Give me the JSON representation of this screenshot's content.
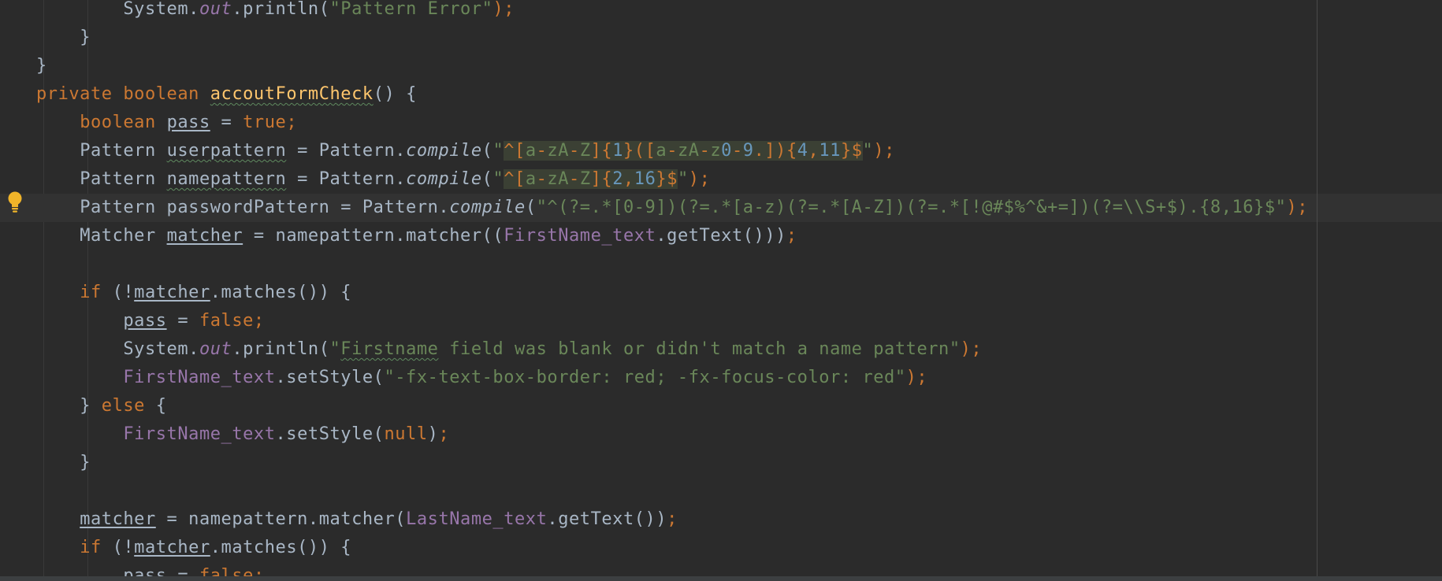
{
  "editor": {
    "colors": {
      "background": "#2b2b2b",
      "keyword": "#cc7832",
      "string": "#6a8759",
      "number": "#6897bb",
      "field": "#9876aa",
      "method_decl": "#ffc66d",
      "plain": "#a9b7c6",
      "intention_bulb": "#f0b429"
    },
    "gutter_icon": "intention-bulb-icon",
    "lines": [
      {
        "indent": "        ",
        "tokens": [
          [
            "plain",
            "System."
          ],
          [
            "st",
            "out"
          ],
          [
            "plain",
            ".println("
          ],
          [
            "str",
            "\"Pattern Error\""
          ],
          [
            "kw",
            ");"
          ]
        ]
      },
      {
        "indent": "    ",
        "tokens": [
          [
            "plain",
            "}"
          ]
        ]
      },
      {
        "indent": "",
        "tokens": [
          [
            "plain",
            "}"
          ]
        ]
      },
      {
        "indent": "",
        "tokens": [
          [
            "kw",
            "private "
          ],
          [
            "kw",
            "boolean "
          ],
          [
            "fn_typo",
            "accoutFormCheck"
          ],
          [
            "plain",
            "() {"
          ]
        ]
      },
      {
        "indent": "    ",
        "tokens": [
          [
            "kw",
            "boolean "
          ],
          [
            "ul",
            "pass"
          ],
          [
            "plain",
            " = "
          ],
          [
            "kw",
            "true;"
          ]
        ]
      },
      {
        "indent": "    ",
        "tokens": [
          [
            "plain",
            "Pattern "
          ],
          [
            "ul_typo",
            "userpattern"
          ],
          [
            "plain",
            " = Pattern."
          ],
          [
            "mc",
            "compile"
          ],
          [
            "plain",
            "("
          ],
          [
            "str",
            "\""
          ],
          [
            "rx",
            "^[a-zA-Z]{1}([a-zA-z0-9.]){4,11}$"
          ],
          [
            "str",
            "\""
          ],
          [
            "kw",
            ");"
          ]
        ]
      },
      {
        "indent": "    ",
        "tokens": [
          [
            "plain",
            "Pattern "
          ],
          [
            "ul_typo",
            "namepattern"
          ],
          [
            "plain",
            " = Pattern."
          ],
          [
            "mc",
            "compile"
          ],
          [
            "plain",
            "("
          ],
          [
            "str",
            "\""
          ],
          [
            "rx",
            "^[a-zA-Z]{2,16}$"
          ],
          [
            "str",
            "\""
          ],
          [
            "kw",
            ");"
          ]
        ]
      },
      {
        "indent": "    ",
        "tokens": [
          [
            "plain",
            "Pattern passwordPattern = Pattern."
          ],
          [
            "mc",
            "compile"
          ],
          [
            "plain",
            "("
          ],
          [
            "str",
            "\"^(?=.*[0-9])(?=.*[a-z)(?=.*[A-Z])(?=.*[!@#$%^&+=])(?=\\\\S+$).{8,16}$\""
          ],
          [
            "kw",
            ");"
          ]
        ]
      },
      {
        "indent": "    ",
        "tokens": [
          [
            "plain",
            "Matcher "
          ],
          [
            "ul",
            "matcher"
          ],
          [
            "plain",
            " = namepattern.matcher(("
          ],
          [
            "fld",
            "FirstName_text"
          ],
          [
            "plain",
            ".getText()))"
          ],
          [
            "kw",
            ";"
          ]
        ]
      },
      {
        "indent": "",
        "tokens": []
      },
      {
        "indent": "    ",
        "tokens": [
          [
            "kw",
            "if "
          ],
          [
            "plain",
            "(!"
          ],
          [
            "ul",
            "matcher"
          ],
          [
            "plain",
            ".matches()) {"
          ]
        ]
      },
      {
        "indent": "        ",
        "tokens": [
          [
            "ul",
            "pass"
          ],
          [
            "plain",
            " = "
          ],
          [
            "kw",
            "false;"
          ]
        ]
      },
      {
        "indent": "        ",
        "tokens": [
          [
            "plain",
            "System."
          ],
          [
            "st",
            "out"
          ],
          [
            "plain",
            ".println("
          ],
          [
            "str",
            "\""
          ],
          [
            "str_typo",
            "Firstname"
          ],
          [
            "str",
            " field was blank or didn't match a name pattern\""
          ],
          [
            "kw",
            ");"
          ]
        ]
      },
      {
        "indent": "        ",
        "tokens": [
          [
            "fld",
            "FirstName_text"
          ],
          [
            "plain",
            ".setStyle("
          ],
          [
            "str",
            "\"-fx-text-box-border: red; -fx-focus-color: red\""
          ],
          [
            "kw",
            ");"
          ]
        ]
      },
      {
        "indent": "    ",
        "tokens": [
          [
            "plain",
            "} "
          ],
          [
            "kw",
            "else "
          ],
          [
            "plain",
            "{"
          ]
        ]
      },
      {
        "indent": "        ",
        "tokens": [
          [
            "fld",
            "FirstName_text"
          ],
          [
            "plain",
            ".setStyle("
          ],
          [
            "kw",
            "null"
          ],
          [
            "plain",
            ")"
          ],
          [
            "kw",
            ";"
          ]
        ]
      },
      {
        "indent": "    ",
        "tokens": [
          [
            "plain",
            "}"
          ]
        ]
      },
      {
        "indent": "",
        "tokens": []
      },
      {
        "indent": "    ",
        "tokens": [
          [
            "ul",
            "matcher"
          ],
          [
            "plain",
            " = namepattern.matcher("
          ],
          [
            "fld",
            "LastName_text"
          ],
          [
            "plain",
            ".getText())"
          ],
          [
            "kw",
            ";"
          ]
        ]
      },
      {
        "indent": "    ",
        "tokens": [
          [
            "kw",
            "if "
          ],
          [
            "plain",
            "(!"
          ],
          [
            "ul",
            "matcher"
          ],
          [
            "plain",
            ".matches()) {"
          ]
        ]
      },
      {
        "indent": "        ",
        "tokens": [
          [
            "ul",
            "pass"
          ],
          [
            "plain",
            " = "
          ],
          [
            "kw",
            "false;"
          ]
        ]
      }
    ]
  }
}
